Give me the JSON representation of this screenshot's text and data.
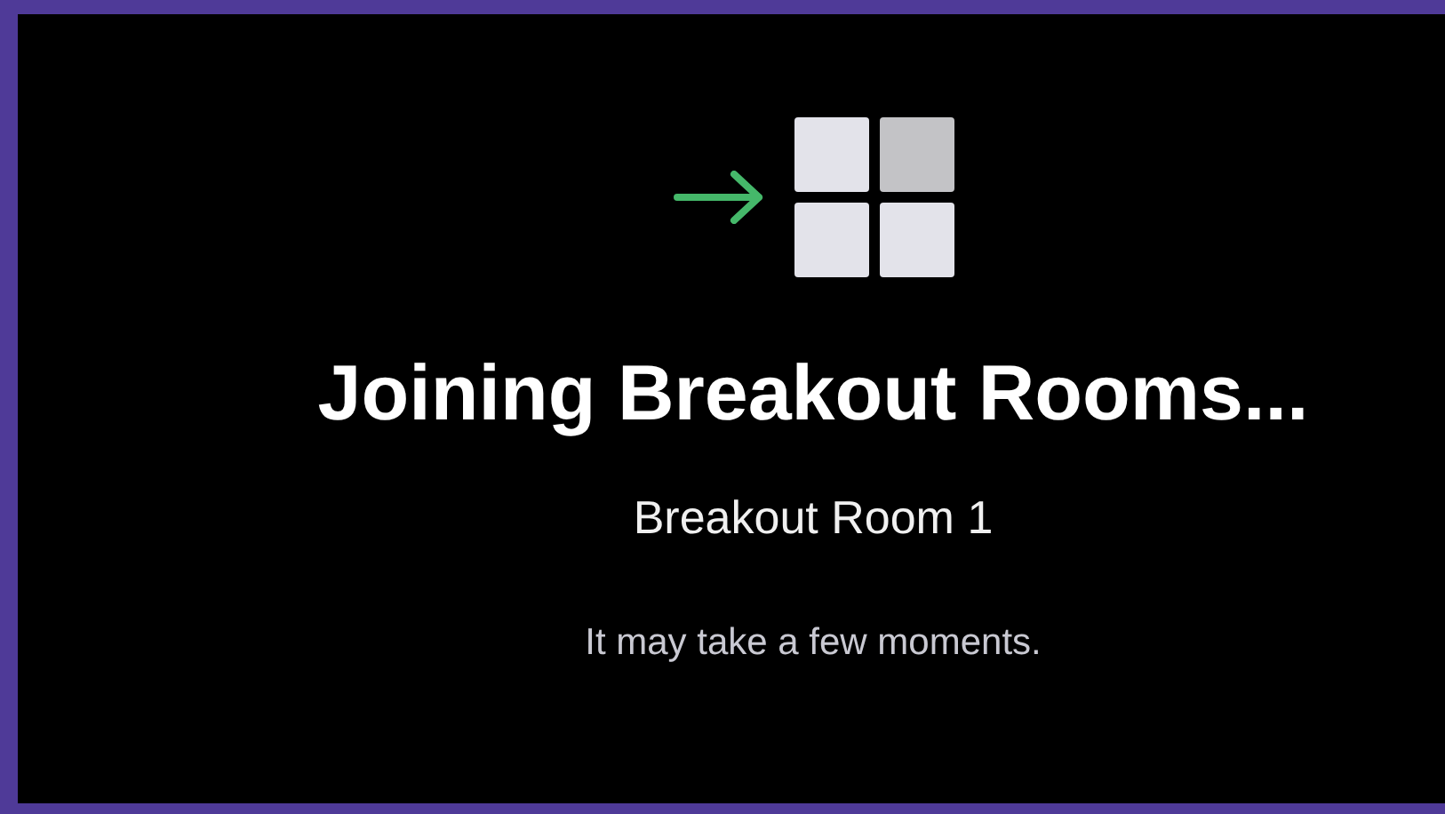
{
  "title": "Joining Breakout Rooms...",
  "room_name": "Breakout Room 1",
  "message": "It may take a few moments."
}
